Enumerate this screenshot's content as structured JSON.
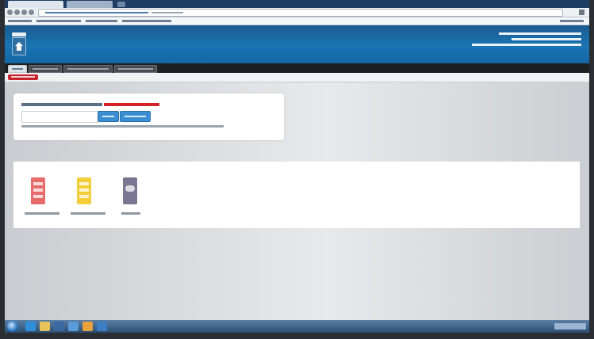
{
  "browser": {
    "tabs": [
      {
        "label": ""
      },
      {
        "label": ""
      }
    ],
    "address": ""
  },
  "header": {
    "title_lines": [
      "",
      "",
      ""
    ]
  },
  "nav": {
    "tabs": [
      {
        "label": "",
        "active": true
      },
      {
        "label": "",
        "active": false
      },
      {
        "label": "",
        "active": false
      },
      {
        "label": "",
        "active": false
      }
    ]
  },
  "subnav": {
    "badge_label": ""
  },
  "login": {
    "prompt_label": "",
    "prompt_note": "",
    "password_placeholder": "",
    "login_button": "",
    "forgot_button": "",
    "help_text": ""
  },
  "apps": [
    {
      "name": "",
      "icon": "document-icon",
      "color": "#e86b6b"
    },
    {
      "name": "",
      "icon": "document-icon",
      "color": "#f2cf3a"
    },
    {
      "name": "",
      "icon": "cloud-icon",
      "color": "#7a7590"
    }
  ],
  "taskbar": {
    "icons": [
      "start-orb-icon",
      "ie-icon",
      "folder-icon",
      "media-icon",
      "app-icon",
      "browser-icon"
    ],
    "clock": ""
  },
  "colors": {
    "header_blue": "#1a74b4",
    "nav_dark": "#1e1f21",
    "badge_red": "#c8212b",
    "button_blue": "#3a8ed3"
  }
}
